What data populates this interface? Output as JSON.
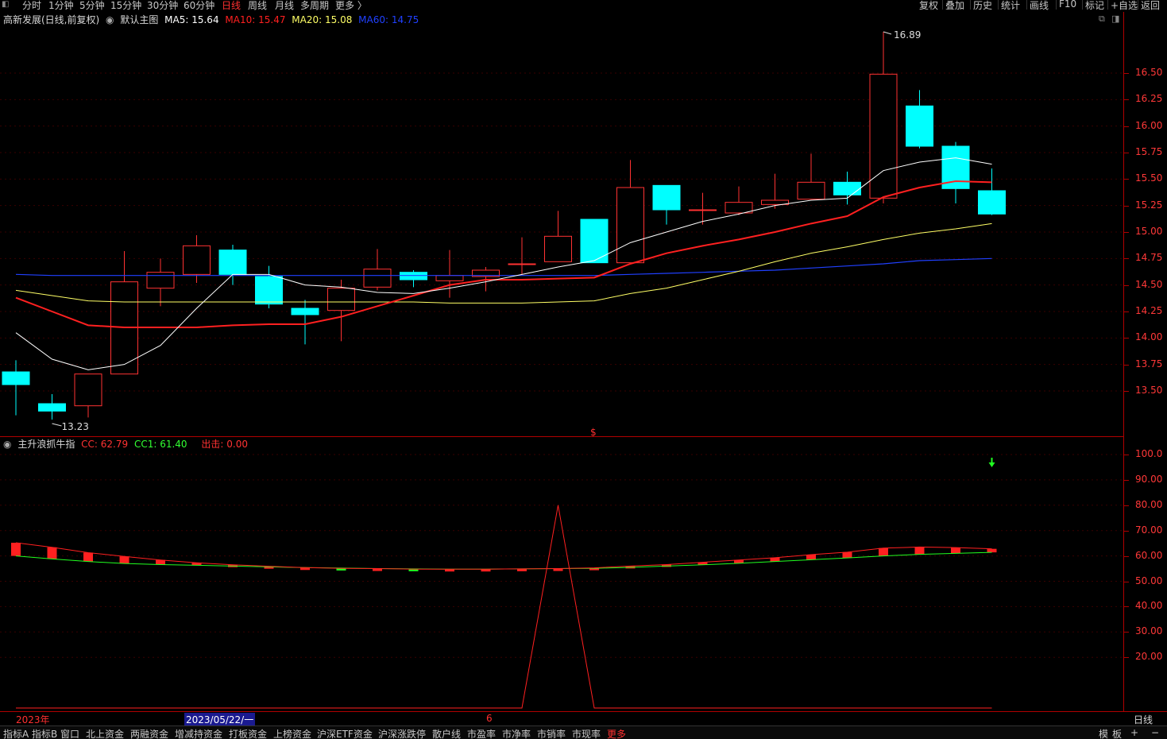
{
  "toolbar": {
    "periods": [
      "分时",
      "1分钟",
      "5分钟",
      "15分钟",
      "30分钟",
      "60分钟",
      "日线",
      "周线",
      "月线",
      "多周期",
      "更多 〉"
    ],
    "active_period": "日线",
    "tools": [
      "复权",
      "叠加",
      "历史",
      "统计",
      "画线",
      "F10",
      "标记",
      "+自选",
      "返回"
    ]
  },
  "main_legend": {
    "stock": "高新发展(日线,前复权)",
    "template": "默认主图",
    "ma5": "MA5: 15.64",
    "ma10": "MA10: 15.47",
    "ma20": "MA20: 15.08",
    "ma60": "MA60: 14.75"
  },
  "indicator_legend": {
    "name": "主升浪抓牛指",
    "cc": "CC: 62.79",
    "cc1": "CC1: 61.40",
    "signal": "出击: 0.00"
  },
  "colors": {
    "up": "#ff3232",
    "down": "#00ffff",
    "ma5": "#ffffff",
    "ma10": "#ff2020",
    "ma20": "#ffff66",
    "ma60": "#2040ff",
    "frame": "#b00000"
  },
  "annotations": {
    "high": "16.89",
    "low": "13.23",
    "dollar": "$"
  },
  "axis": {
    "year": "2023年",
    "cursor_date": "2023/05/22/一",
    "month": "6",
    "right_label": "日线"
  },
  "bottom_tabs": [
    "指标A",
    "指标B",
    "窗口",
    "北上资金",
    "两融资金",
    "增减持资金",
    "打板资金",
    "上榜资金",
    "沪深ETF资金",
    "沪深涨跌停",
    "散户线",
    "市盈率",
    "市净率",
    "市销率",
    "市现率",
    "更多"
  ],
  "bottom_right": [
    "模",
    "板",
    "−",
    "+",
    "−"
  ],
  "chart_data": [
    {
      "type": "candlestick",
      "title": "高新发展(日线,前复权)",
      "ylim": [
        13.05,
        17.0
      ],
      "y_ticks": [
        "16.50",
        "16.25",
        "16.00",
        "15.75",
        "15.50",
        "15.25",
        "15.00",
        "14.75",
        "14.50",
        "14.25",
        "14.00",
        "13.75",
        "13.50"
      ],
      "y_tick_values": [
        16.5,
        16.25,
        16.0,
        15.75,
        15.5,
        15.25,
        15.0,
        14.75,
        14.5,
        14.25,
        14.0,
        13.75,
        13.5
      ],
      "candles": [
        {
          "o": 13.68,
          "c": 13.56,
          "h": 13.79,
          "l": 13.27
        },
        {
          "o": 13.38,
          "c": 13.31,
          "h": 13.47,
          "l": 13.23
        },
        {
          "o": 13.36,
          "c": 13.66,
          "h": 13.66,
          "l": 13.25
        },
        {
          "o": 13.66,
          "c": 14.53,
          "h": 14.82,
          "l": 13.66
        },
        {
          "o": 14.47,
          "c": 14.62,
          "h": 14.75,
          "l": 14.3
        },
        {
          "o": 14.6,
          "c": 14.87,
          "h": 14.97,
          "l": 14.52
        },
        {
          "o": 14.83,
          "c": 14.6,
          "h": 14.88,
          "l": 14.5
        },
        {
          "o": 14.58,
          "c": 14.32,
          "h": 14.68,
          "l": 14.28
        },
        {
          "o": 14.28,
          "c": 14.22,
          "h": 14.36,
          "l": 13.94
        },
        {
          "o": 14.26,
          "c": 14.47,
          "h": 14.55,
          "l": 13.97
        },
        {
          "o": 14.48,
          "c": 14.65,
          "h": 14.84,
          "l": 14.45
        },
        {
          "o": 14.62,
          "c": 14.55,
          "h": 14.64,
          "l": 14.48
        },
        {
          "o": 14.54,
          "c": 14.59,
          "h": 14.83,
          "l": 14.38
        },
        {
          "o": 14.58,
          "c": 14.64,
          "h": 14.67,
          "l": 14.44
        },
        {
          "o": 14.7,
          "c": 14.7,
          "h": 14.95,
          "l": 14.6
        },
        {
          "o": 14.72,
          "c": 14.96,
          "h": 15.2,
          "l": 14.72
        },
        {
          "o": 15.12,
          "c": 14.71,
          "h": 15.12,
          "l": 14.71
        },
        {
          "o": 14.71,
          "c": 15.42,
          "h": 15.68,
          "l": 14.71
        },
        {
          "o": 15.44,
          "c": 15.21,
          "h": 15.44,
          "l": 15.07
        },
        {
          "o": 15.21,
          "c": 15.21,
          "h": 15.37,
          "l": 15.07
        },
        {
          "o": 15.18,
          "c": 15.28,
          "h": 15.43,
          "l": 15.16
        },
        {
          "o": 15.26,
          "c": 15.3,
          "h": 15.55,
          "l": 15.22
        },
        {
          "o": 15.31,
          "c": 15.47,
          "h": 15.74,
          "l": 15.31
        },
        {
          "o": 15.47,
          "c": 15.35,
          "h": 15.57,
          "l": 15.26
        },
        {
          "o": 15.32,
          "c": 16.49,
          "h": 16.89,
          "l": 15.27
        },
        {
          "o": 16.19,
          "c": 15.81,
          "h": 16.34,
          "l": 15.79
        },
        {
          "o": 15.81,
          "c": 15.41,
          "h": 15.85,
          "l": 15.27
        },
        {
          "o": 15.39,
          "c": 15.17,
          "h": 15.6,
          "l": 15.16
        }
      ],
      "ma5": [
        14.05,
        13.8,
        13.7,
        13.75,
        13.93,
        14.28,
        14.6,
        14.6,
        14.5,
        14.48,
        14.43,
        14.42,
        14.47,
        14.53,
        14.6,
        14.67,
        14.73,
        14.9,
        15.0,
        15.1,
        15.17,
        15.25,
        15.3,
        15.32,
        15.58,
        15.66,
        15.7,
        15.64
      ],
      "ma10": [
        14.38,
        14.25,
        14.12,
        14.1,
        14.1,
        14.1,
        14.12,
        14.13,
        14.13,
        14.2,
        14.3,
        14.4,
        14.5,
        14.55,
        14.55,
        14.56,
        14.57,
        14.7,
        14.8,
        14.87,
        14.93,
        15.0,
        15.08,
        15.15,
        15.33,
        15.42,
        15.48,
        15.47
      ],
      "ma20": [
        14.45,
        14.4,
        14.35,
        14.34,
        14.34,
        14.34,
        14.34,
        14.34,
        14.34,
        14.34,
        14.34,
        14.34,
        14.33,
        14.33,
        14.33,
        14.34,
        14.35,
        14.42,
        14.47,
        14.55,
        14.63,
        14.72,
        14.8,
        14.86,
        14.93,
        14.99,
        15.03,
        15.08
      ],
      "ma60": [
        14.6,
        14.59,
        14.59,
        14.59,
        14.59,
        14.59,
        14.59,
        14.59,
        14.59,
        14.59,
        14.59,
        14.59,
        14.59,
        14.59,
        14.59,
        14.59,
        14.59,
        14.6,
        14.61,
        14.62,
        14.63,
        14.64,
        14.66,
        14.68,
        14.7,
        14.73,
        14.74,
        14.75
      ]
    },
    {
      "type": "indicator",
      "title": "主升浪抓牛指",
      "ylim": [
        0,
        108
      ],
      "y_ticks": [
        "100.0",
        "90.00",
        "80.00",
        "70.00",
        "60.00",
        "50.00",
        "40.00",
        "30.00",
        "20.00"
      ],
      "y_tick_values": [
        100,
        90,
        80,
        70,
        60,
        50,
        40,
        30,
        20
      ],
      "cc": [
        65.2,
        63.4,
        61.3,
        59.8,
        58.4,
        57.3,
        56.5,
        55.9,
        55.4,
        55.1,
        55.0,
        54.8,
        54.8,
        54.8,
        54.9,
        55.0,
        55.3,
        56.0,
        56.6,
        57.5,
        58.4,
        59.3,
        60.5,
        61.5,
        63.1,
        63.5,
        63.3,
        62.8
      ],
      "cc1": [
        60.0,
        58.8,
        57.8,
        57.0,
        56.6,
        56.3,
        56.0,
        55.7,
        55.4,
        55.2,
        55.0,
        54.9,
        54.8,
        54.8,
        54.9,
        55.0,
        55.1,
        55.5,
        56.0,
        56.5,
        57.1,
        57.8,
        58.5,
        59.2,
        60.0,
        60.6,
        61.0,
        61.4
      ],
      "signal": [
        0,
        0,
        0,
        0,
        0,
        0,
        0,
        0,
        0,
        0,
        0,
        0,
        0,
        0,
        0,
        80,
        0,
        0,
        0,
        0,
        0,
        0,
        0,
        0,
        0,
        0,
        0,
        0
      ]
    }
  ]
}
